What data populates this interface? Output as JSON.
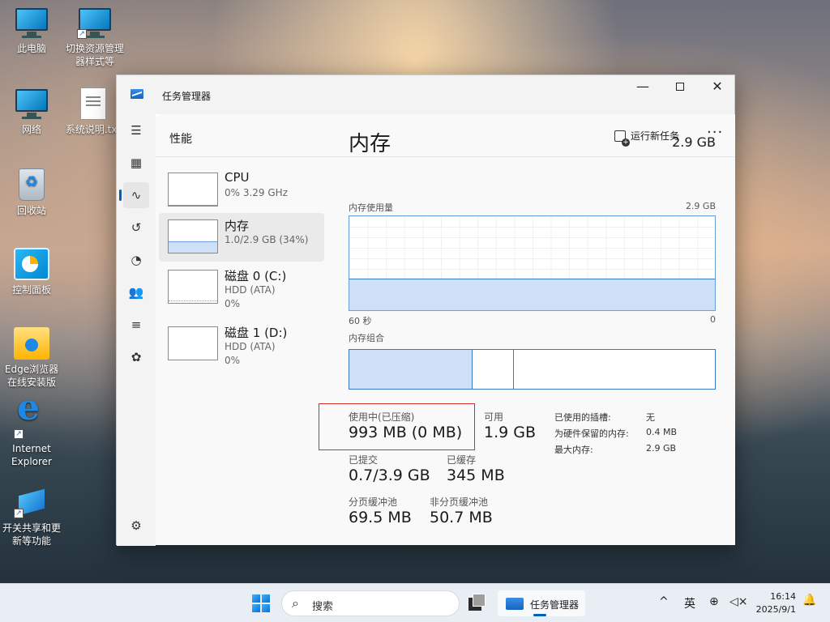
{
  "desktop": {
    "icons": [
      {
        "label": "此电脑",
        "icon": "computer-icon"
      },
      {
        "label": "切换资源管理器样式等",
        "icon": "monitor-shortcut-icon"
      },
      {
        "label": "网络",
        "icon": "network-icon"
      },
      {
        "label": "系统说明.txt",
        "icon": "text-file-icon"
      },
      {
        "label": "回收站",
        "icon": "recycle-bin-icon"
      },
      {
        "label": "控制面板",
        "icon": "control-panel-icon"
      },
      {
        "label": "Edge浏览器在线安装版",
        "icon": "folder-icon"
      },
      {
        "label": "Internet Explorer",
        "icon": "ie-icon"
      },
      {
        "label": "开关共享和更新等功能",
        "icon": "network-share-icon"
      }
    ]
  },
  "window": {
    "title": "任务管理器",
    "page_title": "性能",
    "run_new_task": "运行新任务",
    "more_glyph": "···",
    "devices": [
      {
        "name": "CPU",
        "sub1": "0%  3.29 GHz",
        "sub2": ""
      },
      {
        "name": "内存",
        "sub1": "1.0/2.9 GB (34%)",
        "sub2": ""
      },
      {
        "name": "磁盘 0 (C:)",
        "sub1": "HDD (ATA)",
        "sub2": "0%"
      },
      {
        "name": "磁盘 1 (D:)",
        "sub1": "HDD (ATA)",
        "sub2": "0%"
      }
    ],
    "memory": {
      "title": "内存",
      "total": "2.9 GB",
      "usage_label": "内存使用量",
      "usage_max": "2.9 GB",
      "time_left": "60 秒",
      "time_right": "0",
      "usage_fraction": 0.34,
      "composition_label": "内存组合",
      "in_use_label": "使用中(已压缩)",
      "in_use_value": "993 MB (0 MB)",
      "available_label": "可用",
      "available_value": "1.9 GB",
      "committed_label": "已提交",
      "committed_value": "0.7/3.9 GB",
      "cached_label": "已缓存",
      "cached_value": "345 MB",
      "paged_label": "分页缓冲池",
      "paged_value": "69.5 MB",
      "nonpaged_label": "非分页缓冲池",
      "nonpaged_value": "50.7 MB",
      "slots_label": "已使用的插槽:",
      "slots_value": "无",
      "reserved_label": "为硬件保留的内存:",
      "reserved_value": "0.4 MB",
      "max_label": "最大内存:",
      "max_value": "2.9 GB"
    }
  },
  "taskbar": {
    "search_placeholder": "搜索",
    "app_label": "任务管理器",
    "ime": "英",
    "time": "16:14",
    "date": "2025/9/1"
  }
}
